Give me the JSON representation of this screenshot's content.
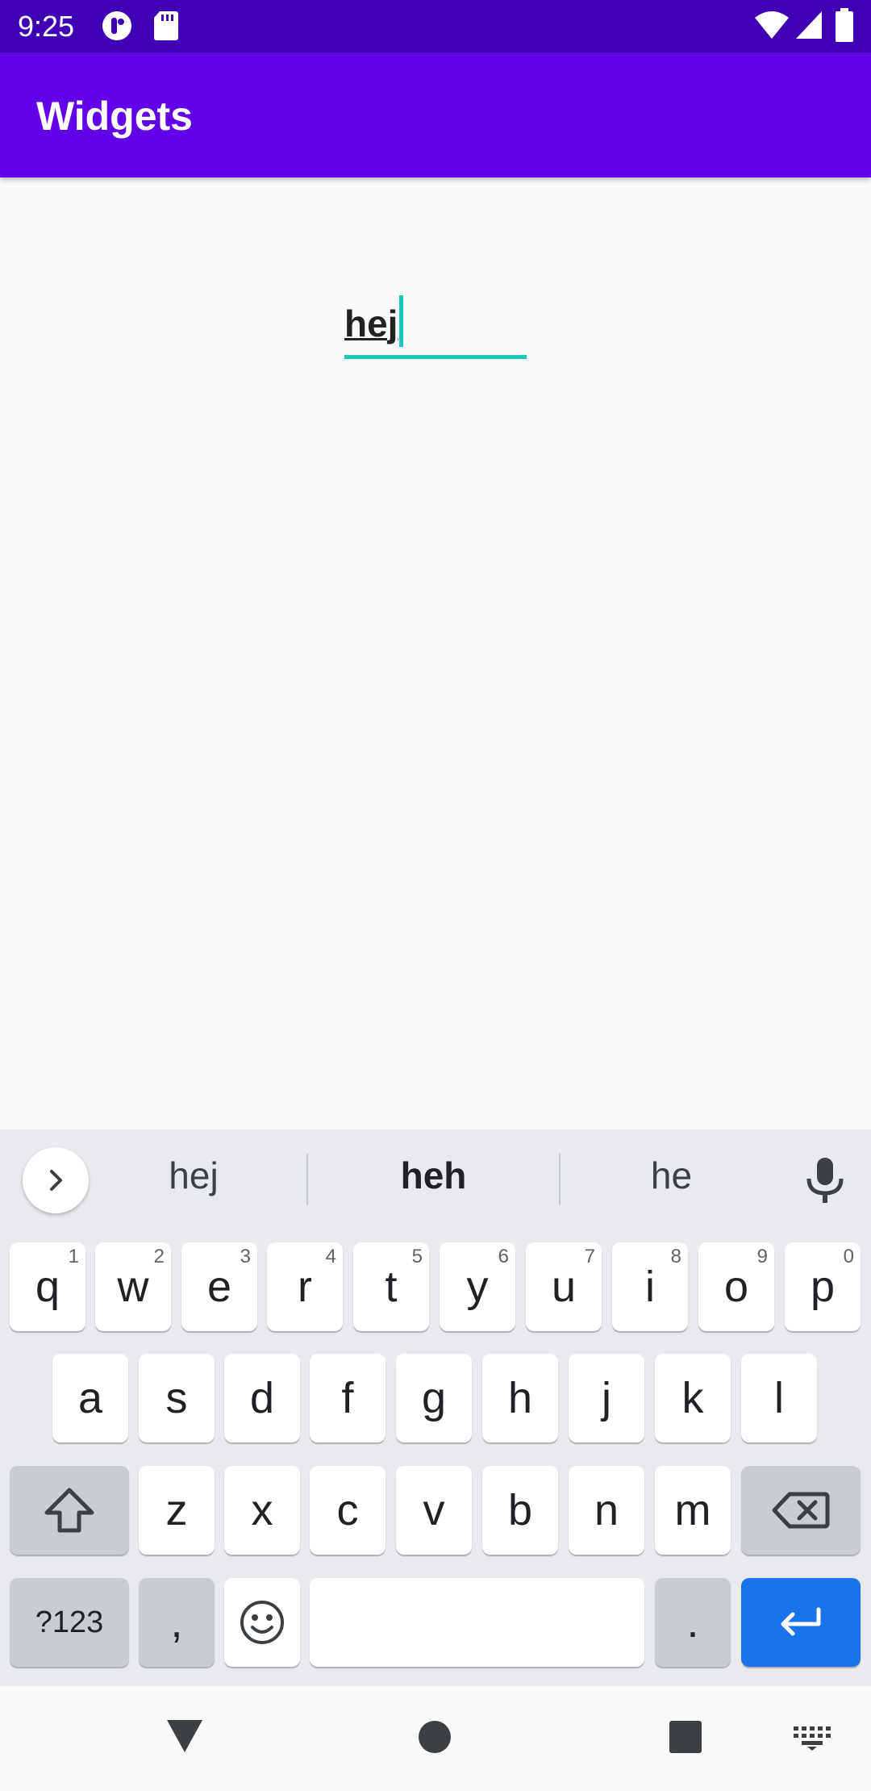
{
  "status_bar": {
    "time": "9:25",
    "left_icons": [
      "notification-app-icon",
      "sd-card-icon"
    ],
    "right_icons": [
      "wifi-icon",
      "cell-signal-icon",
      "battery-icon"
    ]
  },
  "app_bar": {
    "title": "Widgets"
  },
  "text_field": {
    "value": "hej"
  },
  "keyboard": {
    "suggestions": [
      "hej",
      "heh",
      "he"
    ],
    "row1": [
      {
        "label": "q",
        "hint": "1"
      },
      {
        "label": "w",
        "hint": "2"
      },
      {
        "label": "e",
        "hint": "3"
      },
      {
        "label": "r",
        "hint": "4"
      },
      {
        "label": "t",
        "hint": "5"
      },
      {
        "label": "y",
        "hint": "6"
      },
      {
        "label": "u",
        "hint": "7"
      },
      {
        "label": "i",
        "hint": "8"
      },
      {
        "label": "o",
        "hint": "9"
      },
      {
        "label": "p",
        "hint": "0"
      }
    ],
    "row2": [
      "a",
      "s",
      "d",
      "f",
      "g",
      "h",
      "j",
      "k",
      "l"
    ],
    "row3": [
      "z",
      "x",
      "c",
      "v",
      "b",
      "n",
      "m"
    ],
    "symbols_label": "?123",
    "comma_label": ",",
    "period_label": ".",
    "accent_color": "#1a73e8"
  },
  "nav_bar": {
    "icons": [
      "back-icon",
      "home-icon",
      "recents-icon",
      "keyboard-switch-icon"
    ]
  }
}
